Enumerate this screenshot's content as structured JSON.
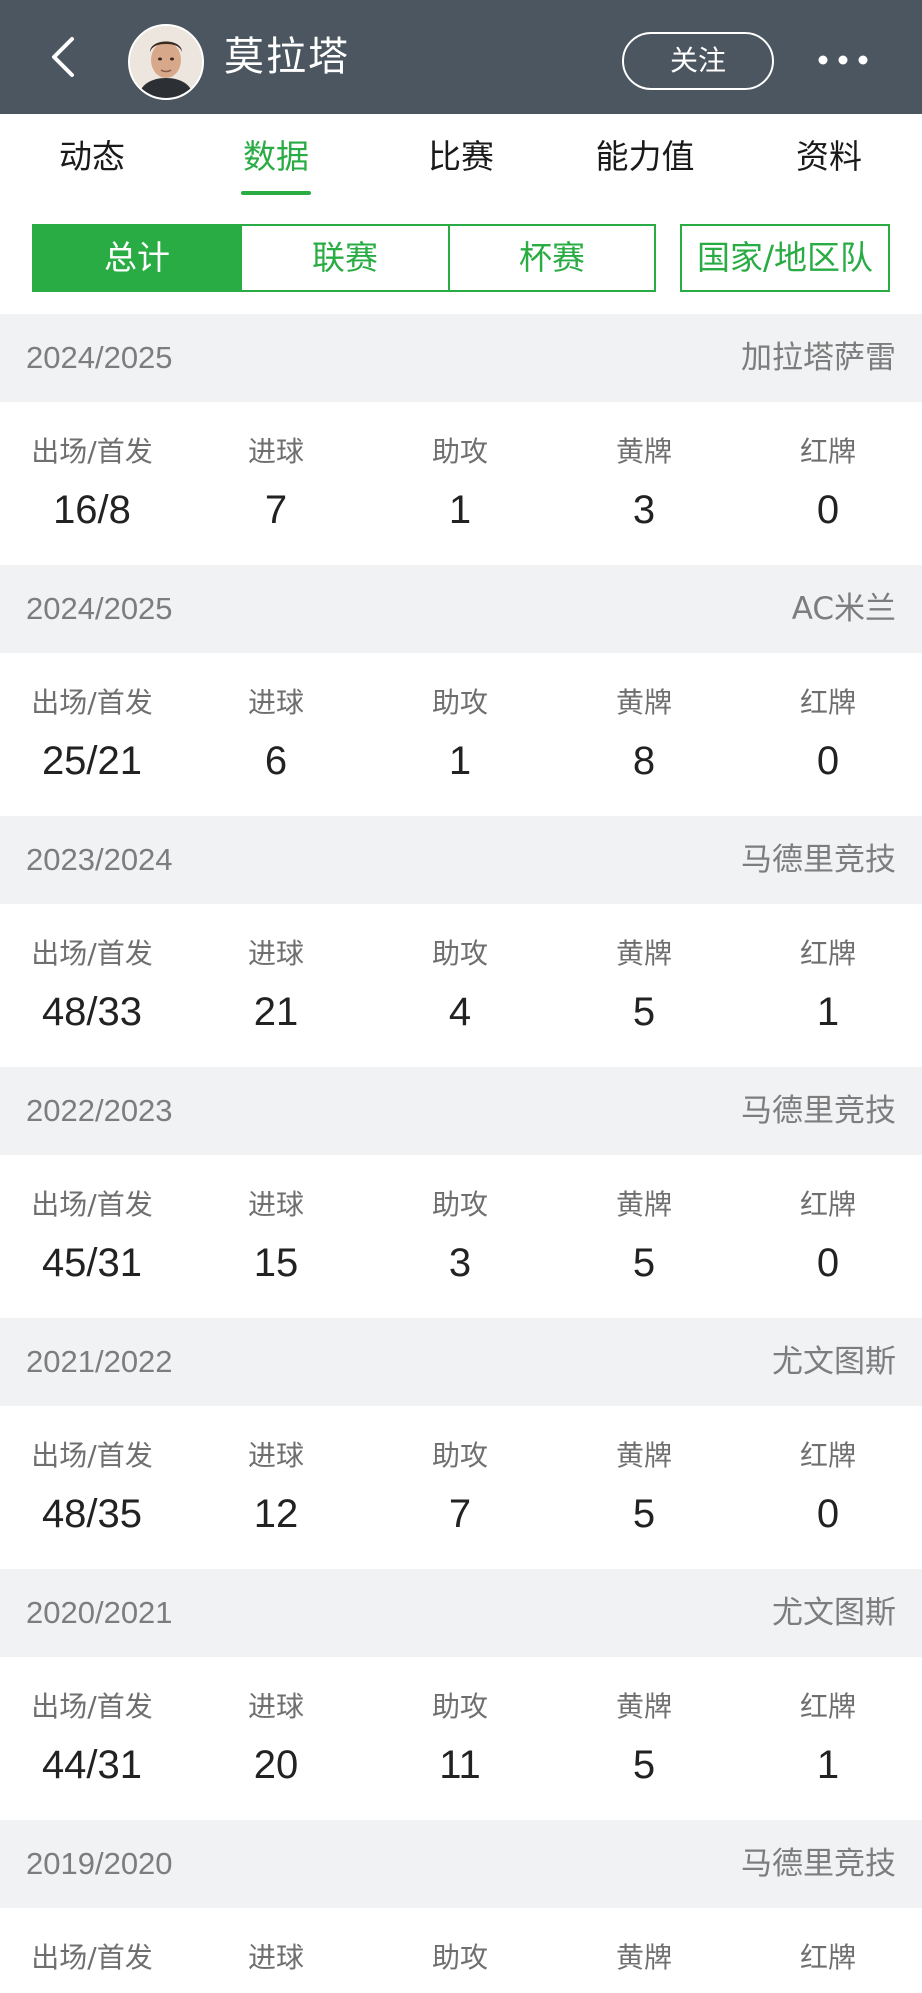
{
  "header": {
    "player_name": "莫拉塔",
    "follow_label": "关注"
  },
  "tabs": [
    {
      "label": "动态",
      "active": false
    },
    {
      "label": "数据",
      "active": true
    },
    {
      "label": "比赛",
      "active": false
    },
    {
      "label": "能力值",
      "active": false
    },
    {
      "label": "资料",
      "active": false
    }
  ],
  "filters": [
    {
      "label": "总计",
      "active": true
    },
    {
      "label": "联赛",
      "active": false
    },
    {
      "label": "杯赛",
      "active": false
    },
    {
      "label": "国家/地区队",
      "active": false
    }
  ],
  "stat_labels": [
    "出场/首发",
    "进球",
    "助攻",
    "黄牌",
    "红牌"
  ],
  "seasons": [
    {
      "season": "2024/2025",
      "club": "加拉塔萨雷",
      "values": [
        "16/8",
        "7",
        "1",
        "3",
        "0"
      ]
    },
    {
      "season": "2024/2025",
      "club": "AC米兰",
      "values": [
        "25/21",
        "6",
        "1",
        "8",
        "0"
      ]
    },
    {
      "season": "2023/2024",
      "club": "马德里竞技",
      "values": [
        "48/33",
        "21",
        "4",
        "5",
        "1"
      ]
    },
    {
      "season": "2022/2023",
      "club": "马德里竞技",
      "values": [
        "45/31",
        "15",
        "3",
        "5",
        "0"
      ]
    },
    {
      "season": "2021/2022",
      "club": "尤文图斯",
      "values": [
        "48/35",
        "12",
        "7",
        "5",
        "0"
      ]
    },
    {
      "season": "2020/2021",
      "club": "尤文图斯",
      "values": [
        "44/31",
        "20",
        "11",
        "5",
        "1"
      ]
    },
    {
      "season": "2019/2020",
      "club": "马德里竞技",
      "values": []
    }
  ],
  "colors": {
    "header_bg": "#4c5660",
    "accent": "#2aac44",
    "section_bg": "#f1f2f4"
  }
}
